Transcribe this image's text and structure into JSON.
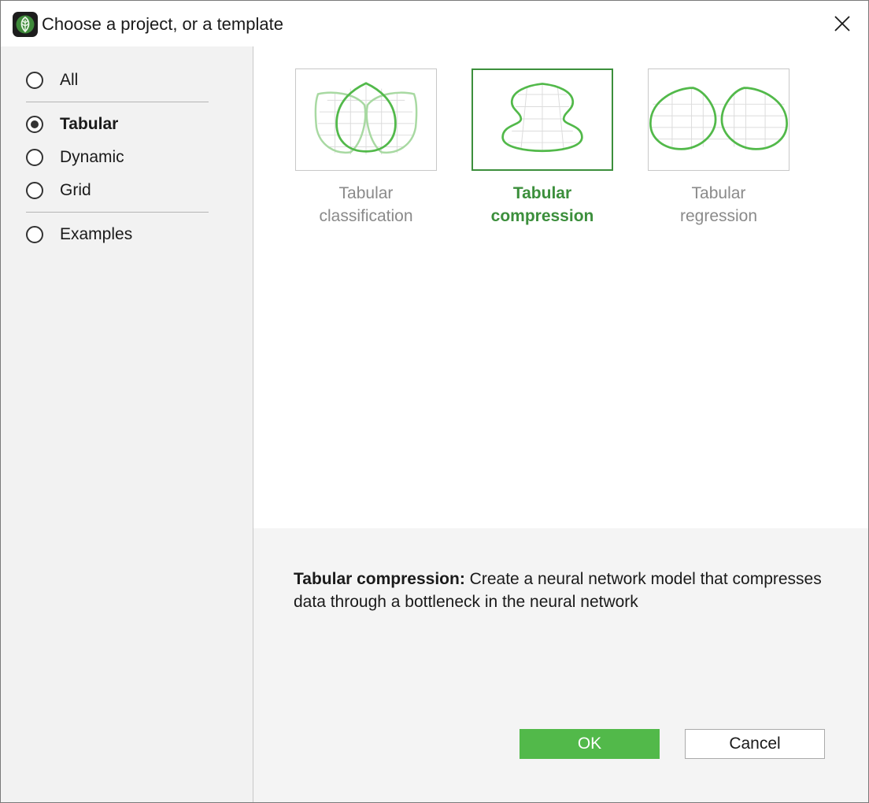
{
  "window": {
    "title": "Choose a project, or a template"
  },
  "sidebar": {
    "items": [
      {
        "label": "All",
        "checked": false
      },
      {
        "label": "Tabular",
        "checked": true
      },
      {
        "label": "Dynamic",
        "checked": false
      },
      {
        "label": "Grid",
        "checked": false
      },
      {
        "label": "Examples",
        "checked": false
      }
    ]
  },
  "templates": [
    {
      "line1": "Tabular",
      "line2": "classification",
      "icon": "tabular-classification-icon",
      "selected": false
    },
    {
      "line1": "Tabular",
      "line2": "compression",
      "icon": "tabular-compression-icon",
      "selected": true
    },
    {
      "line1": "Tabular",
      "line2": "regression",
      "icon": "tabular-regression-icon",
      "selected": false
    }
  ],
  "description": {
    "title": "Tabular compression:",
    "text": "Create a neural network model that compresses data through a bottleneck in the neural network"
  },
  "buttons": {
    "ok": "OK",
    "cancel": "Cancel"
  },
  "colors": {
    "accent": "#52b94a",
    "selected_text": "#3c8f3c",
    "sidebar_bg": "#f2f2f2",
    "panel_bg": "#f4f4f4"
  }
}
